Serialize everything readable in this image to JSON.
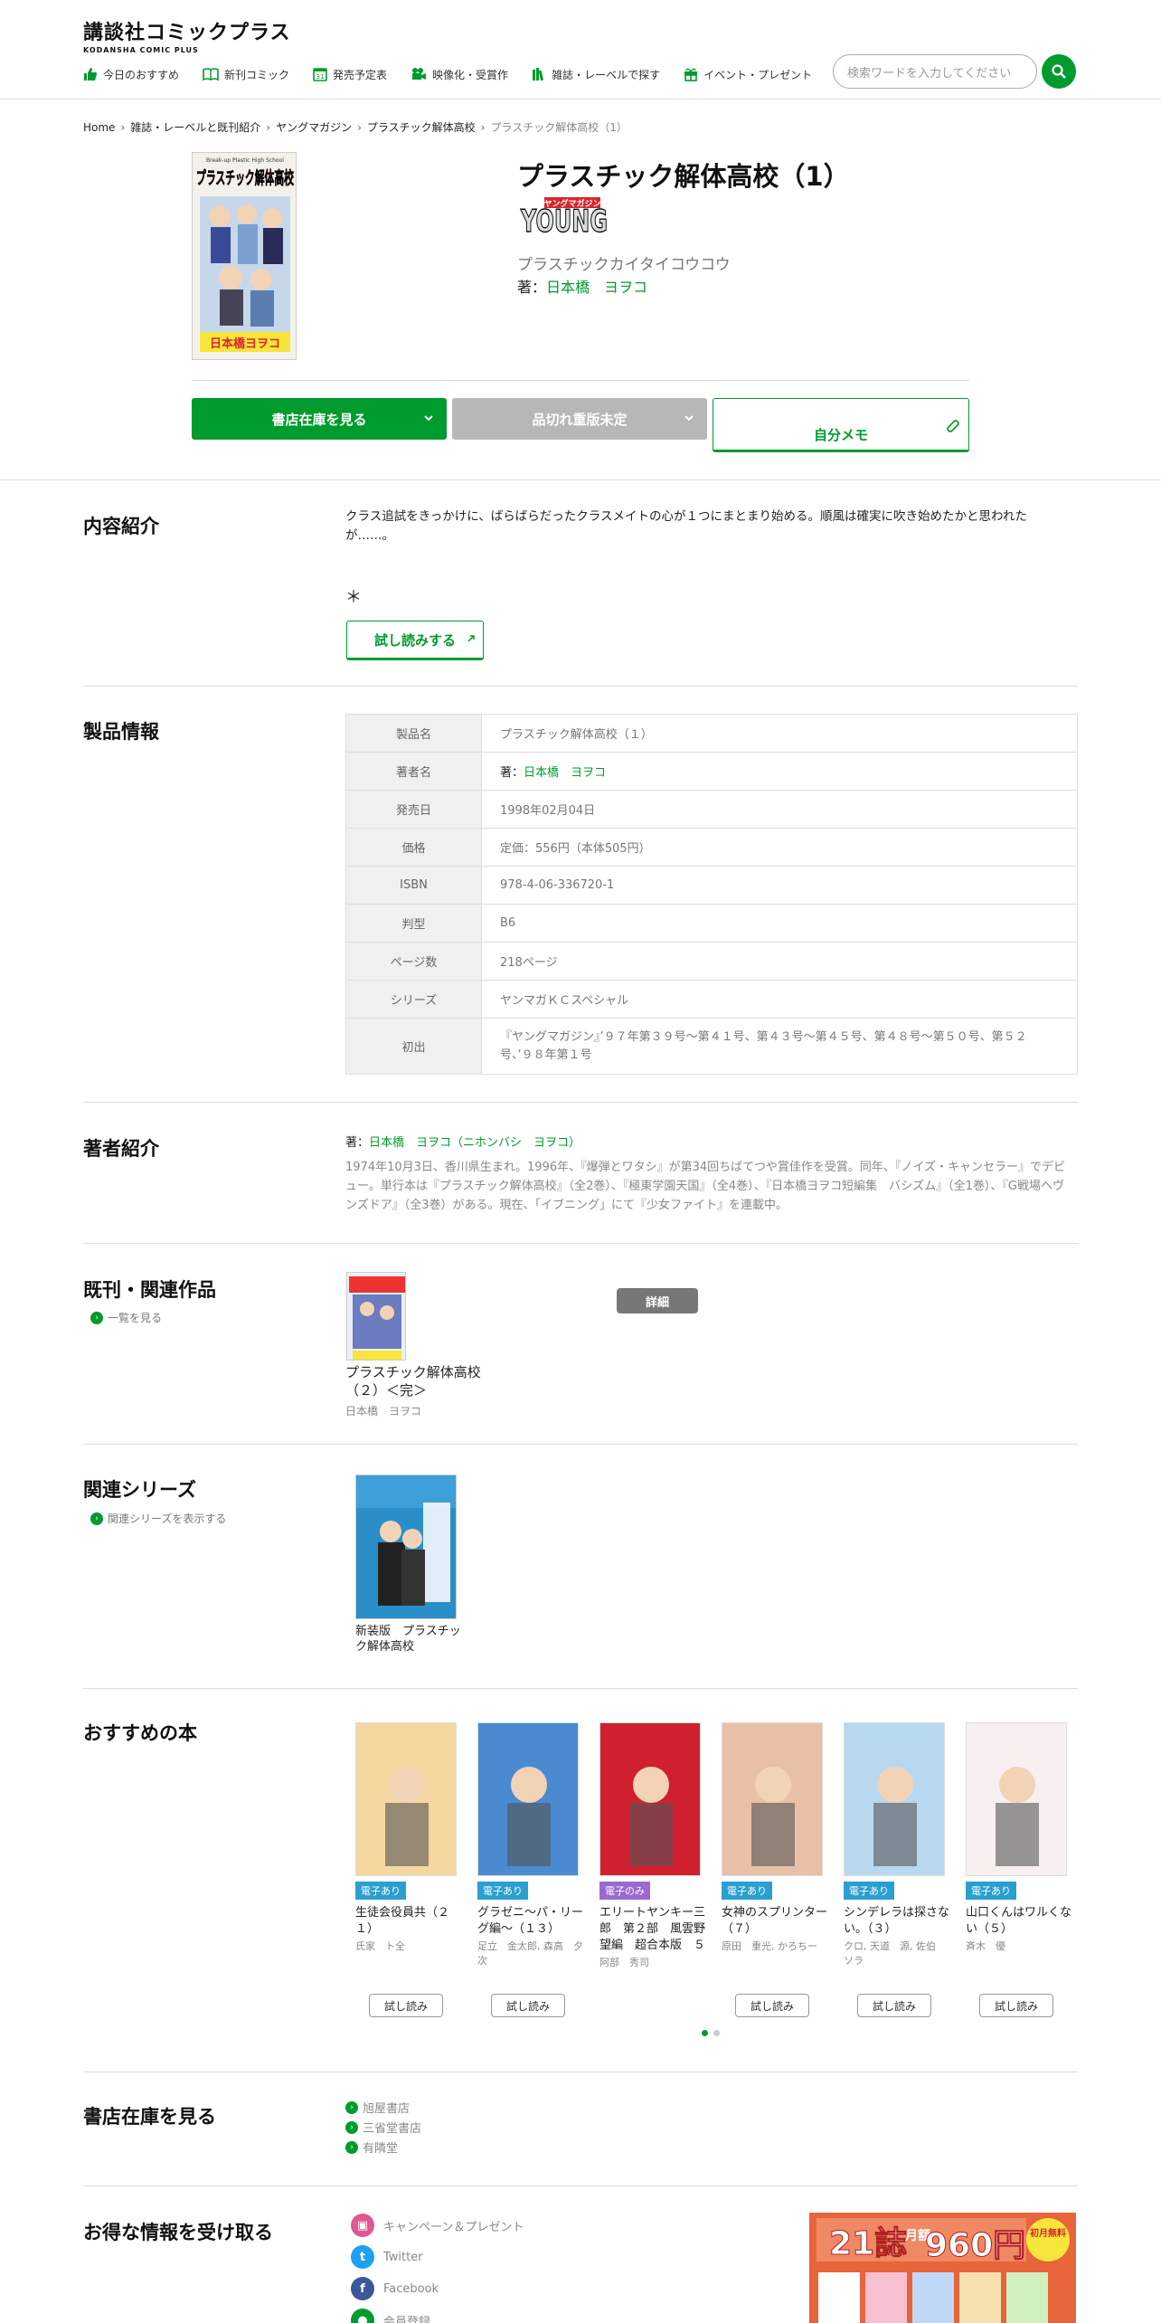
{
  "header": {
    "logo_main": "講談社コミックプラス",
    "logo_sub": "KODANSHA COMIC PLUS",
    "nav": [
      {
        "label": "今日のおすすめ",
        "icon": "thumbs-up-icon"
      },
      {
        "label": "新刊コミック",
        "icon": "open-book-icon"
      },
      {
        "label": "発売予定表",
        "icon": "calendar-icon"
      },
      {
        "label": "映像化・受賞作",
        "icon": "film-camera-icon"
      },
      {
        "label": "雑誌・レーベルで探す",
        "icon": "magazines-icon"
      },
      {
        "label": "イベント・プレゼント",
        "icon": "gift-icon"
      }
    ],
    "search_placeholder": "検索ワードを入力してください"
  },
  "breadcrumb": [
    "Home",
    "雑誌・レーベルと既刊紹介",
    "ヤングマガジン",
    "プラスチック解体高校",
    "プラスチック解体高校（1）"
  ],
  "book": {
    "title": "プラスチック解体高校（1）",
    "magazine_logo": "YOUNG",
    "magazine_logo_small": "ヤングマガジン",
    "kana": "プラスチックカイタイコウコウ",
    "author_prefix": "著：",
    "author": "日本橋　ヨヲコ",
    "cover_title": "プラスチック解体高校",
    "cover_subtitle": "Break-up Plastic High School",
    "cover_author": "日本橋ヨヲコ"
  },
  "buttons": {
    "stock": "書店在庫を見る",
    "out_of_print": "品切れ重版未定",
    "memo": "自分メモ"
  },
  "sections": {
    "content": {
      "title": "内容紹介",
      "text": "クラス追試をきっかけに、ばらばらだったクラスメイトの心が１つにまとまり始める。順風は確実に吹き始めたかと思われたが……。",
      "star": "＊",
      "try_read": "試し読みする"
    },
    "product": {
      "title": "製品情報",
      "rows": [
        {
          "k": "製品名",
          "v": "プラスチック解体高校（１）"
        },
        {
          "k": "著者名",
          "v": "日本橋　ヨヲコ",
          "prefix": "著："
        },
        {
          "k": "発売日",
          "v": "1998年02月04日"
        },
        {
          "k": "価格",
          "v": "定価：556円（本体505円）"
        },
        {
          "k": "ISBN",
          "v": "978-4-06-336720-1"
        },
        {
          "k": "判型",
          "v": "B6"
        },
        {
          "k": "ページ数",
          "v": "218ページ"
        },
        {
          "k": "シリーズ",
          "v": "ヤンマガＫＣスペシャル"
        },
        {
          "k": "初出",
          "v": "『ヤングマガジン』’９７年第３９号～第４１号、第４３号～第４５号、第４８号～第５０号、第５２号、’９８年第１号"
        }
      ]
    },
    "author": {
      "title": "著者紹介",
      "prefix": "著：",
      "name": "日本橋　ヨヲコ（ニホンバシ　ヨヲコ）",
      "bio": "1974年10月3日、香川県生まれ。1996年、『爆弾とワタシ』が第34回ちばてつや賞佳作を受賞。同年、『ノイズ・キャンセラー』でデビュー。単行本は『プラスチック解体高校』（全2巻）、『極東学園天国』（全4巻）、『日本橋ヨヲコ短編集　バシズム』（全1巻）、『G戦場ヘヴンズドア』（全3巻）がある。現在、「イブニング」にて『少女ファイト』を連載中。"
    },
    "related": {
      "title": "既刊・関連作品",
      "link": "一覧を見る",
      "book_title": "プラスチック解体高校（２）＜完＞",
      "book_author": "日本橋　ヨヲコ",
      "detail": "詳細"
    },
    "series": {
      "title": "関連シリーズ",
      "link": "関連シリーズを表示する",
      "book_title": "新装版　プラスチック解体高校"
    },
    "recommend": {
      "title": "おすすめの本",
      "items": [
        {
          "tag": "電子あり",
          "title": "生徒会役員共（２１）",
          "author": "氏家　ト全",
          "tag_color": "#2a9fd0",
          "button": "試し読み",
          "cover_color": "#f5d8a0"
        },
        {
          "tag": "電子あり",
          "title": "グラゼニ～パ・リーグ編～（１３）",
          "author": "足立　金太郎, 森高　夕次",
          "tag_color": "#2a9fd0",
          "button": "試し読み",
          "cover_color": "#4a8ad0"
        },
        {
          "tag": "電子のみ",
          "title": "エリートヤンキー三郎　第２部　風雲野望編　超合本版　５",
          "author": "阿部　秀司",
          "tag_color": "#9a6ad0",
          "button": "",
          "cover_color": "#d02030"
        },
        {
          "tag": "電子あり",
          "title": "女神のスプリンター（７）",
          "author": "原田　重光, かろちー",
          "tag_color": "#2a9fd0",
          "button": "試し読み",
          "cover_color": "#e8c0a8"
        },
        {
          "tag": "電子あり",
          "title": "シンデレラは探さない。（３）",
          "author": "クロ, 天道　源, 佐伯　ソラ",
          "tag_color": "#2a9fd0",
          "button": "試し読み",
          "cover_color": "#b8d8f0"
        },
        {
          "tag": "電子あり",
          "title": "山口くんはワルくない（５）",
          "author": "斉木　優",
          "tag_color": "#2a9fd0",
          "button": "試し読み",
          "cover_color": "#f8f0f0"
        }
      ]
    },
    "stores": {
      "title": "書店在庫を見る",
      "items": [
        "旭屋書店",
        "三省堂書店",
        "有隣堂"
      ]
    },
    "info": {
      "title": "お得な情報を受け取る",
      "items": [
        {
          "label": "キャンペーン＆プレゼント",
          "icon": "gift-icon",
          "color": "#e05890"
        },
        {
          "label": "Twitter",
          "icon": "twitter-icon",
          "color": "#1da1f2"
        },
        {
          "label": "Facebook",
          "icon": "facebook-icon",
          "color": "#3b5998"
        },
        {
          "label": "会員登録",
          "icon": "member-icon",
          "color": "#009b2e"
        }
      ],
      "ad_text_1": "21誌",
      "ad_text_2": "960円",
      "ad_text_3": "月額",
      "ad_text_4": "初月無料"
    }
  },
  "colors": {
    "accent": "#009b2e",
    "disabled": "#b7b7b7"
  }
}
